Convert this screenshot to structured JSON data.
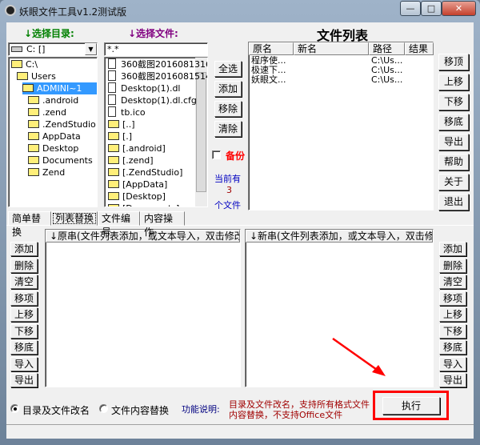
{
  "window": {
    "title": "妖眼文件工具v1.2测试版",
    "min": "—",
    "max": "□",
    "close": "✕"
  },
  "left": {
    "dir_label": "↓选择目录:",
    "file_label": "↓选择文件:",
    "drive": "C: []",
    "filter": "*.*",
    "tree": [
      {
        "label": "C:\\",
        "level": 0,
        "open": true
      },
      {
        "label": "Users",
        "level": 1,
        "open": true
      },
      {
        "label": "ADMINI~1",
        "level": 2,
        "open": true,
        "selected": true
      },
      {
        "label": ".android",
        "level": 3
      },
      {
        "label": ".zend",
        "level": 3
      },
      {
        "label": ".ZendStudio",
        "level": 3
      },
      {
        "label": "AppData",
        "level": 3
      },
      {
        "label": "Desktop",
        "level": 3
      },
      {
        "label": "Documents",
        "level": 3
      },
      {
        "label": "Zend",
        "level": 3
      }
    ],
    "files": [
      {
        "label": "360截图2016081316",
        "type": "file"
      },
      {
        "label": "360截图2016081514",
        "type": "file"
      },
      {
        "label": "Desktop(1).dl",
        "type": "file"
      },
      {
        "label": "Desktop(1).dl.cfg",
        "type": "file"
      },
      {
        "label": "tb.ico",
        "type": "file"
      },
      {
        "label": "[..]",
        "type": "folder"
      },
      {
        "label": "[.]",
        "type": "folder"
      },
      {
        "label": "[.android]",
        "type": "folder"
      },
      {
        "label": "[.zend]",
        "type": "folder"
      },
      {
        "label": "[.ZendStudio]",
        "type": "folder"
      },
      {
        "label": "[AppData]",
        "type": "folder"
      },
      {
        "label": "[Desktop]",
        "type": "folder"
      },
      {
        "label": "[Documents]",
        "type": "folder"
      }
    ]
  },
  "mid": {
    "buttons": [
      "全选",
      "添加",
      "移除",
      "清除"
    ],
    "backup": "备份",
    "count_pre": "当前有",
    "count": "3",
    "count_post": "个文件"
  },
  "filelist": {
    "title": "文件列表",
    "columns": [
      "原名",
      "新名",
      "路径",
      "结果"
    ],
    "rows": [
      [
        "程序使...",
        "",
        "C:\\Us...",
        ""
      ],
      [
        "极速下...",
        "",
        "C:\\Us...",
        ""
      ],
      [
        "妖眼文...",
        "",
        "C:\\Us...",
        ""
      ]
    ],
    "buttons": [
      "移顶",
      "上移",
      "下移",
      "移底",
      "导出",
      "帮助",
      "关于",
      "退出"
    ]
  },
  "tabs": [
    {
      "label": "简单替换"
    },
    {
      "label": "列表替换",
      "active": true
    },
    {
      "label": "文件编号"
    },
    {
      "label": "内容操作"
    }
  ],
  "panel": {
    "left_buttons": [
      "添加",
      "删除",
      "清空",
      "移项",
      "上移",
      "下移",
      "移底",
      "导入",
      "导出"
    ],
    "right_buttons": [
      "添加",
      "删除",
      "清空",
      "移项",
      "上移",
      "下移",
      "移底",
      "导入",
      "导出"
    ],
    "list1_header": "↓原串(文件列表添加，或文本导入，双击修改)",
    "list2_header": "↓新串(文件列表添加，或文本导入，双击修..."
  },
  "bottom": {
    "radio1": "目录及文件改名",
    "radio2": "文件内容替换",
    "info_label": "功能说明:",
    "info_line1": "目录及文件改名，支持所有格式文件",
    "info_line2": "内容替换，不支持Office文件",
    "execute": "执行"
  },
  "colors": {
    "green": "#008000",
    "purple": "#800080",
    "red": "#ff0000",
    "darkred": "#a00000",
    "blue": "#0000c0",
    "highlight": "#3399ff"
  }
}
